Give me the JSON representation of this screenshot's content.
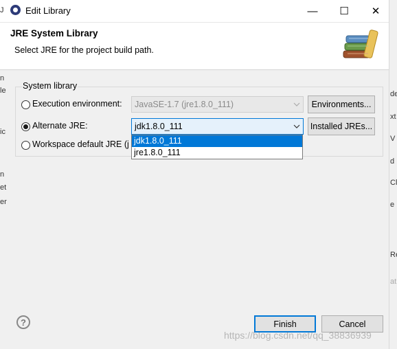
{
  "window": {
    "title": "Edit Library",
    "controls": {
      "minimize": "—",
      "maximize": "☐",
      "close": "✕"
    }
  },
  "header": {
    "title": "JRE System Library",
    "subtitle": "Select JRE for the project build path."
  },
  "group": {
    "label": "System library",
    "options": {
      "execution_env": {
        "label": "Execution environment:",
        "selected": false,
        "combo_value": "JavaSE-1.7 (jre1.8.0_111)",
        "button": "Environments..."
      },
      "alternate_jre": {
        "label": "Alternate JRE:",
        "selected": true,
        "combo_value": "jdk1.8.0_111",
        "button": "Installed JREs..."
      },
      "workspace_default": {
        "label": "Workspace default JRE (j",
        "selected": false
      }
    }
  },
  "dropdown": {
    "items": [
      "jdk1.8.0_111",
      "jre1.8.0_111"
    ],
    "selected_index": 0
  },
  "footer": {
    "help_glyph": "?",
    "finish": "Finish",
    "cancel": "Cancel"
  },
  "background": {
    "left_fragments": [
      "J",
      "n",
      "le",
      "ic",
      "n",
      "et",
      "er"
    ],
    "right_fragments": [
      "de",
      "xt",
      "V",
      "d",
      "Cl",
      "e",
      "Re",
      "at"
    ]
  },
  "watermark": "https://blog.csdn.net/qq_38836939",
  "colors": {
    "accent": "#0078d7",
    "dialog_bg": "#f0f0f0",
    "finish_border": "#0078d7"
  }
}
